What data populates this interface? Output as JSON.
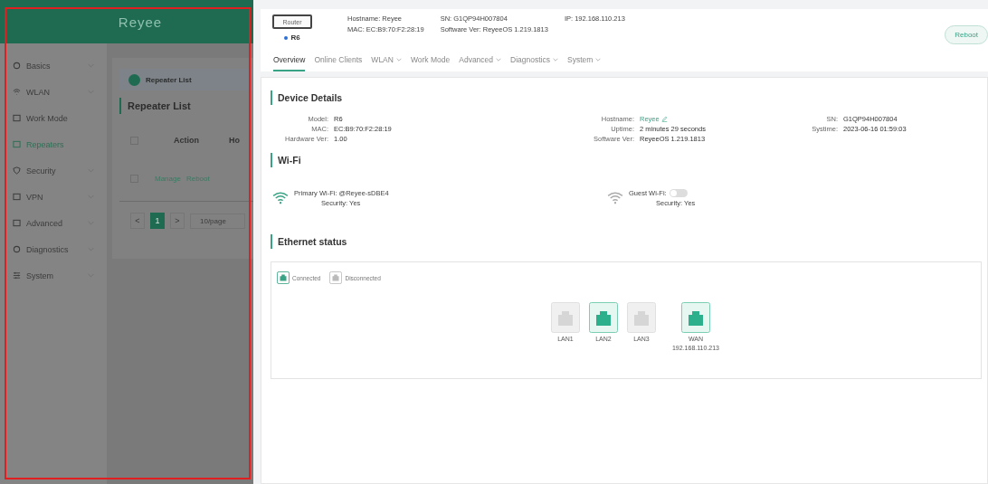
{
  "brand": "Reyee",
  "sidebar": {
    "items": [
      {
        "label": "Basics",
        "expandable": true,
        "selected": false
      },
      {
        "label": "WLAN",
        "expandable": true,
        "selected": false
      },
      {
        "label": "Work Mode",
        "expandable": false,
        "selected": false
      },
      {
        "label": "Repeaters",
        "expandable": false,
        "selected": true
      },
      {
        "label": "Security",
        "expandable": true,
        "selected": false
      },
      {
        "label": "VPN",
        "expandable": true,
        "selected": false
      },
      {
        "label": "Advanced",
        "expandable": true,
        "selected": false
      },
      {
        "label": "Diagnostics",
        "expandable": true,
        "selected": false
      },
      {
        "label": "System",
        "expandable": true,
        "selected": false
      }
    ]
  },
  "repeater_panel": {
    "banner": "Repeater List",
    "heading": "Repeater List",
    "columns": [
      "Action",
      "Ho"
    ],
    "header_checked": false,
    "rows": [
      {
        "checked": false,
        "actions": [
          "Manage",
          "Reboot"
        ]
      }
    ],
    "pagination": {
      "prev": "<",
      "page": "1",
      "next": ">",
      "page_size": "10/page"
    }
  },
  "device_header": {
    "device_label": "Router",
    "model": "R6",
    "fields": [
      {
        "label": "Hostname:",
        "value": "Reyee"
      },
      {
        "label": "MAC:",
        "value": "EC:B9:70:F2:28:19"
      },
      {
        "label": "SN:",
        "value": "G1QP94H007804"
      },
      {
        "label": "Software Ver:",
        "value": "ReyeeOS 1.219.1813"
      },
      {
        "label": "IP:",
        "value": "192.168.110.213"
      }
    ],
    "reboot": "Reboot"
  },
  "tabs": [
    {
      "label": "Overview",
      "selected": true,
      "dropdown": false
    },
    {
      "label": "Online Clients",
      "selected": false,
      "dropdown": false
    },
    {
      "label": "WLAN",
      "selected": false,
      "dropdown": true
    },
    {
      "label": "Work Mode",
      "selected": false,
      "dropdown": false
    },
    {
      "label": "Advanced",
      "selected": false,
      "dropdown": true
    },
    {
      "label": "Diagnostics",
      "selected": false,
      "dropdown": true
    },
    {
      "label": "System",
      "selected": false,
      "dropdown": true
    }
  ],
  "device_details": {
    "title": "Device Details",
    "columns": [
      [
        {
          "label": "Model:",
          "value": "R6"
        },
        {
          "label": "MAC:",
          "value": "EC:B9:70:F2:28:19"
        },
        {
          "label": "Hardware Ver:",
          "value": "1.00"
        }
      ],
      [
        {
          "label": "Hostname:",
          "value": "Reyee",
          "link": true
        },
        {
          "label": "Uptime:",
          "value": "2 minutes 29 seconds"
        },
        {
          "label": "Software Ver:",
          "value": "ReyeeOS 1.219.1813"
        }
      ],
      [
        {
          "label": "SN:",
          "value": "G1QP94H007804"
        },
        {
          "label": "Systime:",
          "value": "2023-06-16 01:59:03"
        }
      ]
    ]
  },
  "wifi": {
    "title": "Wi-Fi",
    "networks": [
      {
        "label": "Primary Wi-Fi:",
        "value": "@Reyee-sDBE4",
        "kind": "text",
        "on": true,
        "security": "Security: Yes"
      },
      {
        "label": "Guest Wi-Fi:",
        "kind": "toggle",
        "on": false,
        "security": "Security: Yes"
      }
    ]
  },
  "ethernet": {
    "title": "Ethernet status",
    "legend": [
      {
        "label": "Connected",
        "connected": true
      },
      {
        "label": "Disconnected",
        "connected": false
      }
    ],
    "ports": [
      {
        "label": "LAN1",
        "connected": false
      },
      {
        "label": "LAN2",
        "connected": true
      },
      {
        "label": "LAN3",
        "connected": false
      },
      {
        "label": "WAN",
        "connected": true,
        "ip": "192.168.110.213"
      }
    ]
  }
}
